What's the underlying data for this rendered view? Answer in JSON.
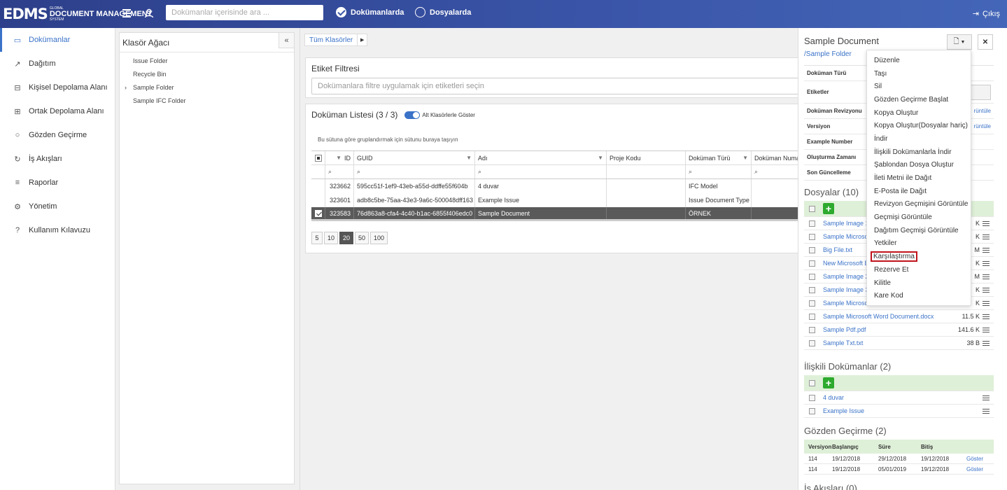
{
  "topbar": {
    "logo_big": "EDMS",
    "logo_small_1": "GLOBAL",
    "logo_small_2": "DOCUMENT MANAGEMENT",
    "logo_small_3": "SYSTEM",
    "search_placeholder": "Dokümanlar içerisinde ara ...",
    "radio_docs": "Dokümanlarda",
    "radio_files": "Dosyalarda",
    "logout": "Çıkış"
  },
  "nav": {
    "items": [
      {
        "label": "Dokümanlar",
        "icon": "folder-icon"
      },
      {
        "label": "Dağıtım",
        "icon": "share-icon"
      },
      {
        "label": "Kişisel Depolama Alanı",
        "icon": "inbox-icon"
      },
      {
        "label": "Ortak Depolama Alanı",
        "icon": "grid-icon"
      },
      {
        "label": "Gözden Geçirme",
        "icon": "chat-icon"
      },
      {
        "label": "İş Akışları",
        "icon": "refresh-icon"
      },
      {
        "label": "Raporlar",
        "icon": "list-icon"
      },
      {
        "label": "Yönetim",
        "icon": "gear-icon"
      },
      {
        "label": "Kullanım Kılavuzu",
        "icon": "help-icon"
      }
    ]
  },
  "tree": {
    "title": "Klasör Ağacı",
    "collapse": "«",
    "items": [
      "Issue Folder",
      "Recycle Bin",
      "Sample Folder",
      "Sample IFC Folder"
    ]
  },
  "main": {
    "breadcrumb": "Tüm Klasörler",
    "tag_filter_title": "Etiket Filtresi",
    "tag_filter_placeholder": "Dokümanlara filtre uygulamak için etiketleri seçin",
    "list_title": "Doküman Listesi (3 / 3)",
    "toggle_label": "Alt Klasörlerle Göster",
    "group_hint": "Bu sütuna göre gruplandırmak için sütunu buraya taşıyın",
    "columns": [
      "ID",
      "GUID",
      "Adı",
      "Proje Kodu",
      "Doküman Türü",
      "Doküman Numa"
    ],
    "rows": [
      {
        "id": "323662",
        "guid": "595cc51f-1ef9-43eb-a55d-ddffe55f604b",
        "name": "4 duvar",
        "project": "",
        "type": "IFC Model",
        "number": ""
      },
      {
        "id": "323601",
        "guid": "adb8c5be-75aa-43e3-9a6c-500048dff163",
        "name": "Example Issue",
        "project": "",
        "type": "Issue Document Type",
        "number": ""
      },
      {
        "id": "323583",
        "guid": "76d863a8-cfa4-4c40-b1ac-6855f406edc0",
        "name": "Sample Document",
        "project": "",
        "type": "ÖRNEK",
        "number": ""
      }
    ],
    "page_sizes": [
      "5",
      "10",
      "20",
      "50",
      "100"
    ],
    "active_page_size": "20"
  },
  "right": {
    "title": "Sample Document",
    "path": "/Sample Folder",
    "props": [
      {
        "label": "Doküman Türü",
        "value": ""
      },
      {
        "label": "Etiketler",
        "value": ""
      },
      {
        "label": "Doküman Revizyonu",
        "value": "rüntüle"
      },
      {
        "label": "Versiyon",
        "value": "rüntüle"
      },
      {
        "label": "Example Number",
        "value": ""
      },
      {
        "label": "Oluşturma Zamanı",
        "value": ""
      },
      {
        "label": "Son Güncelleme",
        "value": ""
      }
    ],
    "files_title": "Dosyalar (10)",
    "files": [
      {
        "name": "Sample Image 1",
        "size": "K"
      },
      {
        "name": "Sample Microso",
        "size": "K"
      },
      {
        "name": "Big File.txt",
        "size": "M"
      },
      {
        "name": "New Microsoft E",
        "size": "K"
      },
      {
        "name": "Sample Image 2",
        "size": "M"
      },
      {
        "name": "Sample Image 3",
        "size": "K"
      },
      {
        "name": "Sample Microso",
        "size": "K"
      },
      {
        "name": "Sample Microsoft Word Document.docx",
        "size": "11.5 K"
      },
      {
        "name": "Sample Pdf.pdf",
        "size": "141.6 K"
      },
      {
        "name": "Sample Txt.txt",
        "size": "38 B"
      }
    ],
    "related_title": "İlişkili Dokümanlar (2)",
    "related": [
      "4 duvar",
      "Example Issue"
    ],
    "review_title": "Gözden Geçirme (2)",
    "review_cols": [
      "Versiyon",
      "Başlangıç",
      "Süre",
      "Bitiş"
    ],
    "reviews": [
      {
        "v": "114",
        "start": "19/12/2018",
        "dur": "29/12/2018",
        "end": "19/12/2018",
        "action": "Göster"
      },
      {
        "v": "114",
        "start": "19/12/2018",
        "dur": "05/01/2019",
        "end": "19/12/2018",
        "action": "Göster"
      }
    ],
    "workflow_title": "İş Akışları (0)"
  },
  "dropdown": {
    "items": [
      "Düzenle",
      "Taşı",
      "Sil",
      "Gözden Geçirme Başlat",
      "Kopya Oluştur",
      "Kopya Oluştur(Dosyalar hariç)",
      "İndir",
      "İlişkili Dokümanlarla İndir",
      "Şablondan Dosya Oluştur",
      "İleti Metni ile Dağıt",
      "E-Posta ile Dağıt",
      "Revizyon Geçmişini Görüntüle",
      "Geçmişi Görüntüle",
      "Dağıtım Geçmişi Görüntüle",
      "Yetkiler",
      "Karşılaştırma",
      "Rezerve Et",
      "Kilitle",
      "Kare Kod"
    ],
    "highlighted": "Karşılaştırma"
  },
  "colors": {
    "topbar": "#3a55a8",
    "accent": "#3a72c8",
    "highlight_border": "#c0141c",
    "add_button": "#2eaa2e"
  }
}
